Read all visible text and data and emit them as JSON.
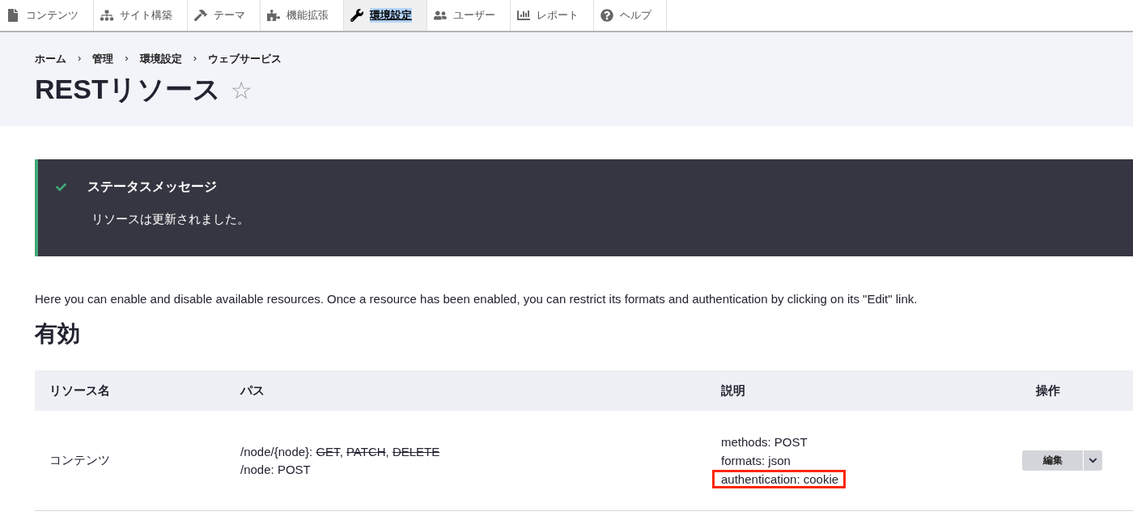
{
  "toolbar": {
    "items": [
      {
        "label": "コンテンツ",
        "selected": false
      },
      {
        "label": "サイト構築",
        "selected": false
      },
      {
        "label": "テーマ",
        "selected": false
      },
      {
        "label": "機能拡張",
        "selected": false
      },
      {
        "label": "環境設定",
        "selected": true
      },
      {
        "label": "ユーザー",
        "selected": false
      },
      {
        "label": "レポート",
        "selected": false
      },
      {
        "label": "ヘルプ",
        "selected": false
      }
    ]
  },
  "breadcrumb": {
    "separator": "›",
    "items": [
      "ホーム",
      "管理",
      "環境設定",
      "ウェブサービス"
    ]
  },
  "page_title": "RESTリソース",
  "favorite_star": "☆",
  "status_message": {
    "title": "ステータスメッセージ",
    "text": "リソースは更新されました。"
  },
  "description": "Here you can enable and disable available resources. Once a resource has been enabled, you can restrict its formats and authentication by clicking on its \"Edit\" link.",
  "section_title": "有効",
  "table": {
    "columns": [
      "リソース名",
      "パス",
      "説明",
      "操作"
    ],
    "rows": [
      {
        "name": "コンテンツ",
        "paths": [
          {
            "path": "/node/{node}:",
            "methods": [
              {
                "label": "GET",
                "disabled": true,
                "separator": ","
              },
              {
                "label": "PATCH",
                "disabled": true,
                "separator": ","
              },
              {
                "label": "DELETE",
                "disabled": true
              }
            ]
          },
          {
            "path": "/node:",
            "methods": [
              {
                "label": "POST",
                "disabled": false
              }
            ]
          }
        ],
        "details": [
          {
            "text": "methods: POST",
            "highlighted": false
          },
          {
            "text": "formats: json",
            "highlighted": false
          },
          {
            "text": "authentication: cookie",
            "highlighted": true
          }
        ],
        "action": "編集"
      }
    ]
  }
}
